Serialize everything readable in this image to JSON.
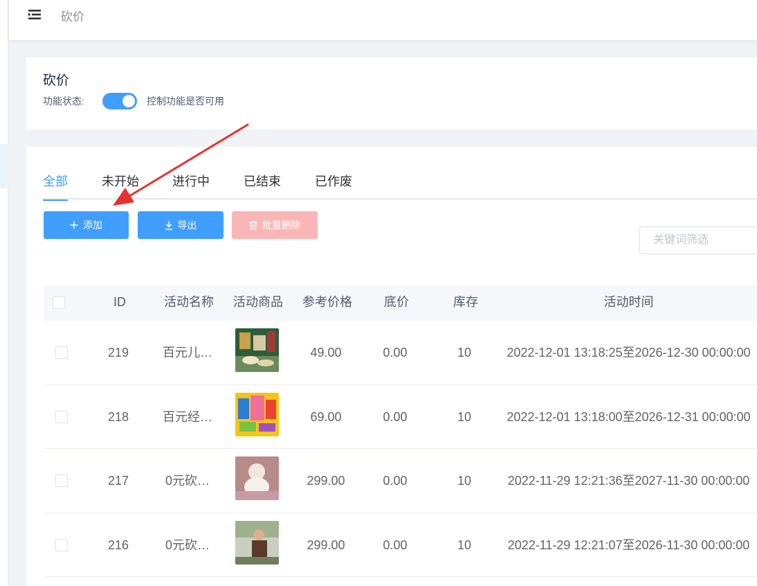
{
  "header": {
    "breadcrumb": "砍价"
  },
  "config": {
    "title": "砍价",
    "status_label": "功能状态:",
    "status_on": true,
    "status_desc": "控制功能是否可用"
  },
  "tabs": [
    {
      "label": "全部",
      "active": true
    },
    {
      "label": "未开始",
      "active": false
    },
    {
      "label": "进行中",
      "active": false
    },
    {
      "label": "已结束",
      "active": false
    },
    {
      "label": "已作废",
      "active": false
    }
  ],
  "toolbar": {
    "add_label": "添加",
    "export_label": "导出",
    "batch_delete_label": "批量删除"
  },
  "search": {
    "placeholder": "关键词筛选"
  },
  "table": {
    "columns": [
      "ID",
      "活动名称",
      "活动商品",
      "参考价格",
      "底价",
      "库存",
      "活动时间"
    ],
    "rows": [
      {
        "id": "219",
        "name": "百元儿…",
        "price": "49.00",
        "floor": "0.00",
        "stock": "10",
        "time": "2022-12-01 13:18:25至2026-12-30 00:00:00"
      },
      {
        "id": "218",
        "name": "百元经…",
        "price": "69.00",
        "floor": "0.00",
        "stock": "10",
        "time": "2022-12-01 13:18:00至2026-12-31 00:00:00"
      },
      {
        "id": "217",
        "name": "0元砍…",
        "price": "299.00",
        "floor": "0.00",
        "stock": "10",
        "time": "2022-11-29 12:21:36至2027-11-30 00:00:00"
      },
      {
        "id": "216",
        "name": "0元砍…",
        "price": "299.00",
        "floor": "0.00",
        "stock": "10",
        "time": "2022-11-29 12:21:07至2026-11-30 00:00:00"
      }
    ]
  },
  "colors": {
    "primary": "#409eff",
    "danger_disabled": "#fab6b6",
    "annotation_arrow": "#e8312f"
  }
}
